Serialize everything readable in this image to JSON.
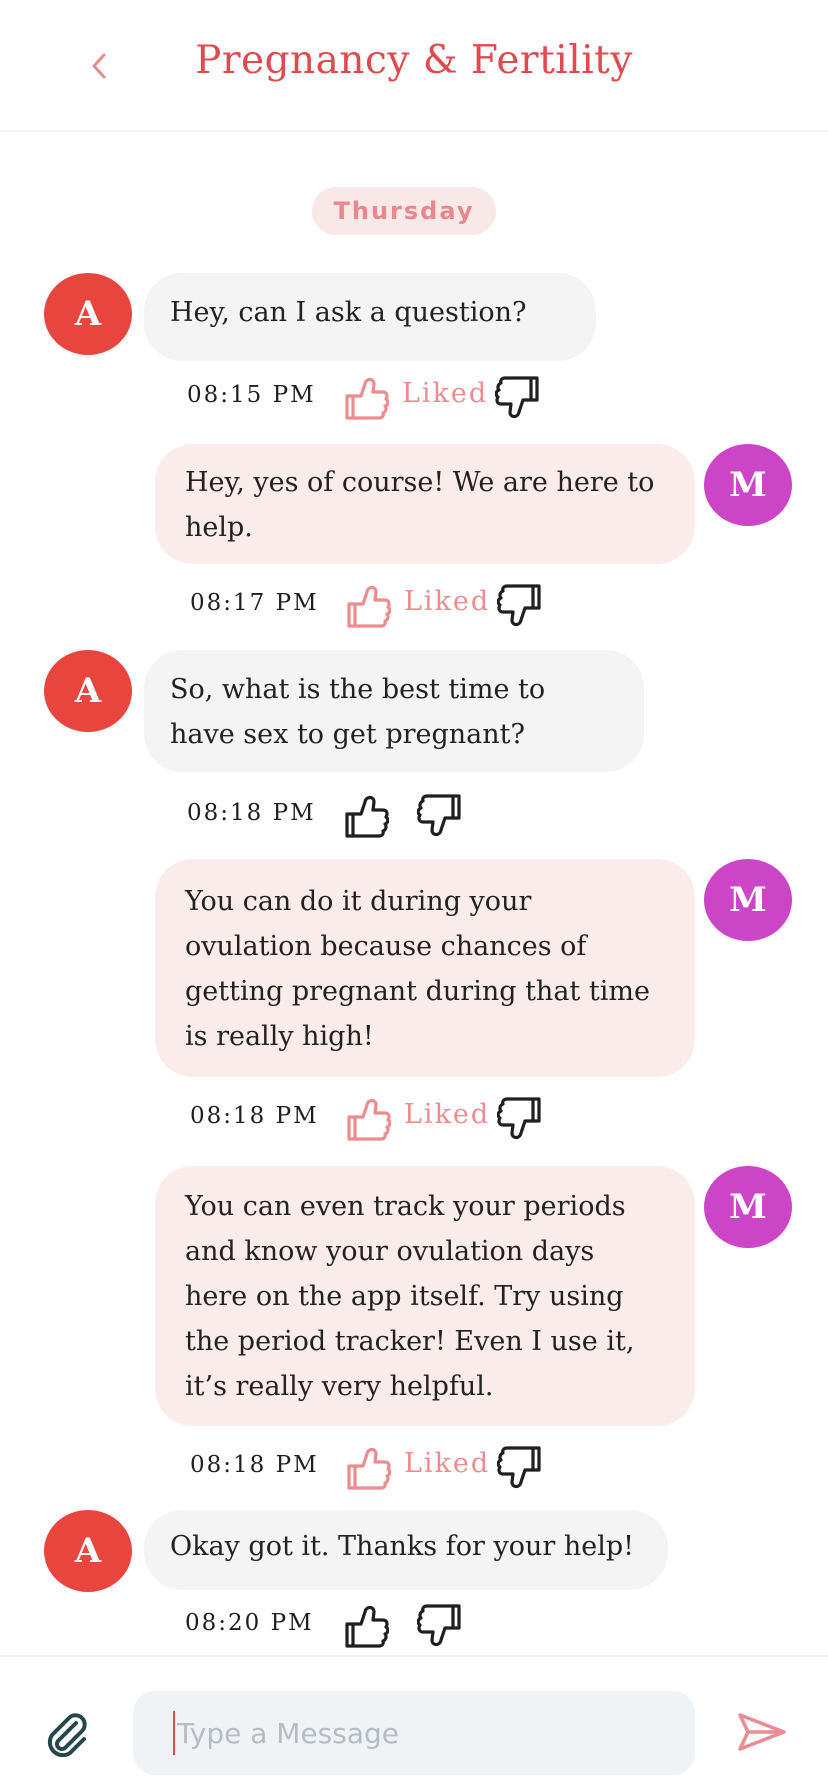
{
  "header": {
    "title": "Pregnancy & Fertility"
  },
  "day_label": "Thursday",
  "liked_label": "Liked",
  "colors": {
    "accent": "#e04a4e",
    "avatar_a": "#e8453e",
    "avatar_m": "#cc45c6",
    "incoming_bubble": "#f4f4f5",
    "outgoing_bubble": "#f9eceb",
    "liked_pink": "#ec8c90"
  },
  "messages": [
    {
      "sender": "A",
      "direction": "incoming",
      "text": "Hey, can I ask a question?",
      "time": "08:15 PM",
      "liked": true
    },
    {
      "sender": "M",
      "direction": "outgoing",
      "text": "Hey, yes of course! We are here to help.",
      "time": "08:17 PM",
      "liked": true
    },
    {
      "sender": "A",
      "direction": "incoming",
      "text": "So, what is the best time to have sex to get pregnant?",
      "time": "08:18 PM",
      "liked": false
    },
    {
      "sender": "M",
      "direction": "outgoing",
      "text": "You can do it during your ovulation because chances of getting pregnant during that time is really high!",
      "time": "08:18 PM",
      "liked": true
    },
    {
      "sender": "M",
      "direction": "outgoing",
      "text": " You can even track your periods and know your ovulation days here on the app itself. Try using the period tracker! Even I use it, it’s really very helpful.",
      "time": "08:18 PM",
      "liked": true
    },
    {
      "sender": "A",
      "direction": "incoming",
      "text": "Okay got it. Thanks for your help!",
      "time": "08:20 PM",
      "liked": false
    }
  ],
  "composer": {
    "placeholder": "Type a Message",
    "value": ""
  },
  "icons": {
    "back": "chevron-left-icon",
    "like": "thumbs-up-icon",
    "dislike": "thumbs-down-icon",
    "attach": "paperclip-icon",
    "send": "send-icon"
  }
}
